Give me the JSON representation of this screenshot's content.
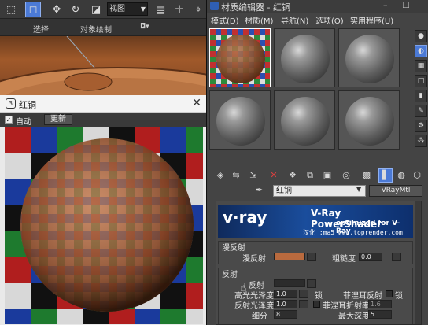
{
  "max_toolbar": {
    "view_dropdown": "视图"
  },
  "ribbon": {
    "select_label": "选择",
    "object_paint_label": "对象绘制"
  },
  "preview": {
    "title": "红铜",
    "auto_label": "自动",
    "update_label": "更新"
  },
  "editor": {
    "title": "材质编辑器 - 红铜",
    "menu": [
      "模式(D)",
      "材质(M)",
      "导航(N)",
      "选项(O)",
      "实用程序(U)"
    ],
    "material_name": "红铜",
    "material_type": "VRayMtl",
    "banner": {
      "logo": "v·ray",
      "product": "V-Ray PowerShader",
      "tagline": "optimized for V-Ray",
      "credit": "汉化 :ma5 www.toprender.com"
    },
    "diffuse": {
      "group_title": "漫反射",
      "diffuse_label": "漫反射",
      "roughness_label": "粗糙度",
      "roughness_value": "0.0",
      "diffuse_color": "#b96a3e"
    },
    "reflection": {
      "group_title": "反射",
      "reflect_label": "反射",
      "hilight_gloss_label": "高光光泽度",
      "hilight_gloss_value": "1.0",
      "lock_label": "L",
      "lock_label_full": "锁",
      "fresnel_label": "菲涅耳反射",
      "refl_gloss_label": "反射光泽度",
      "refl_gloss_value": "1.0",
      "fresnel_ior_label": "菲涅耳折射率",
      "fresnel_ior_value": "1.6",
      "subdivs_label": "细分",
      "subdivs_value": "8",
      "max_depth_label": "最大深度",
      "max_depth_value": "5"
    }
  },
  "colors": {
    "accent": "#4b7ad6",
    "copper": "#b96a3e"
  }
}
